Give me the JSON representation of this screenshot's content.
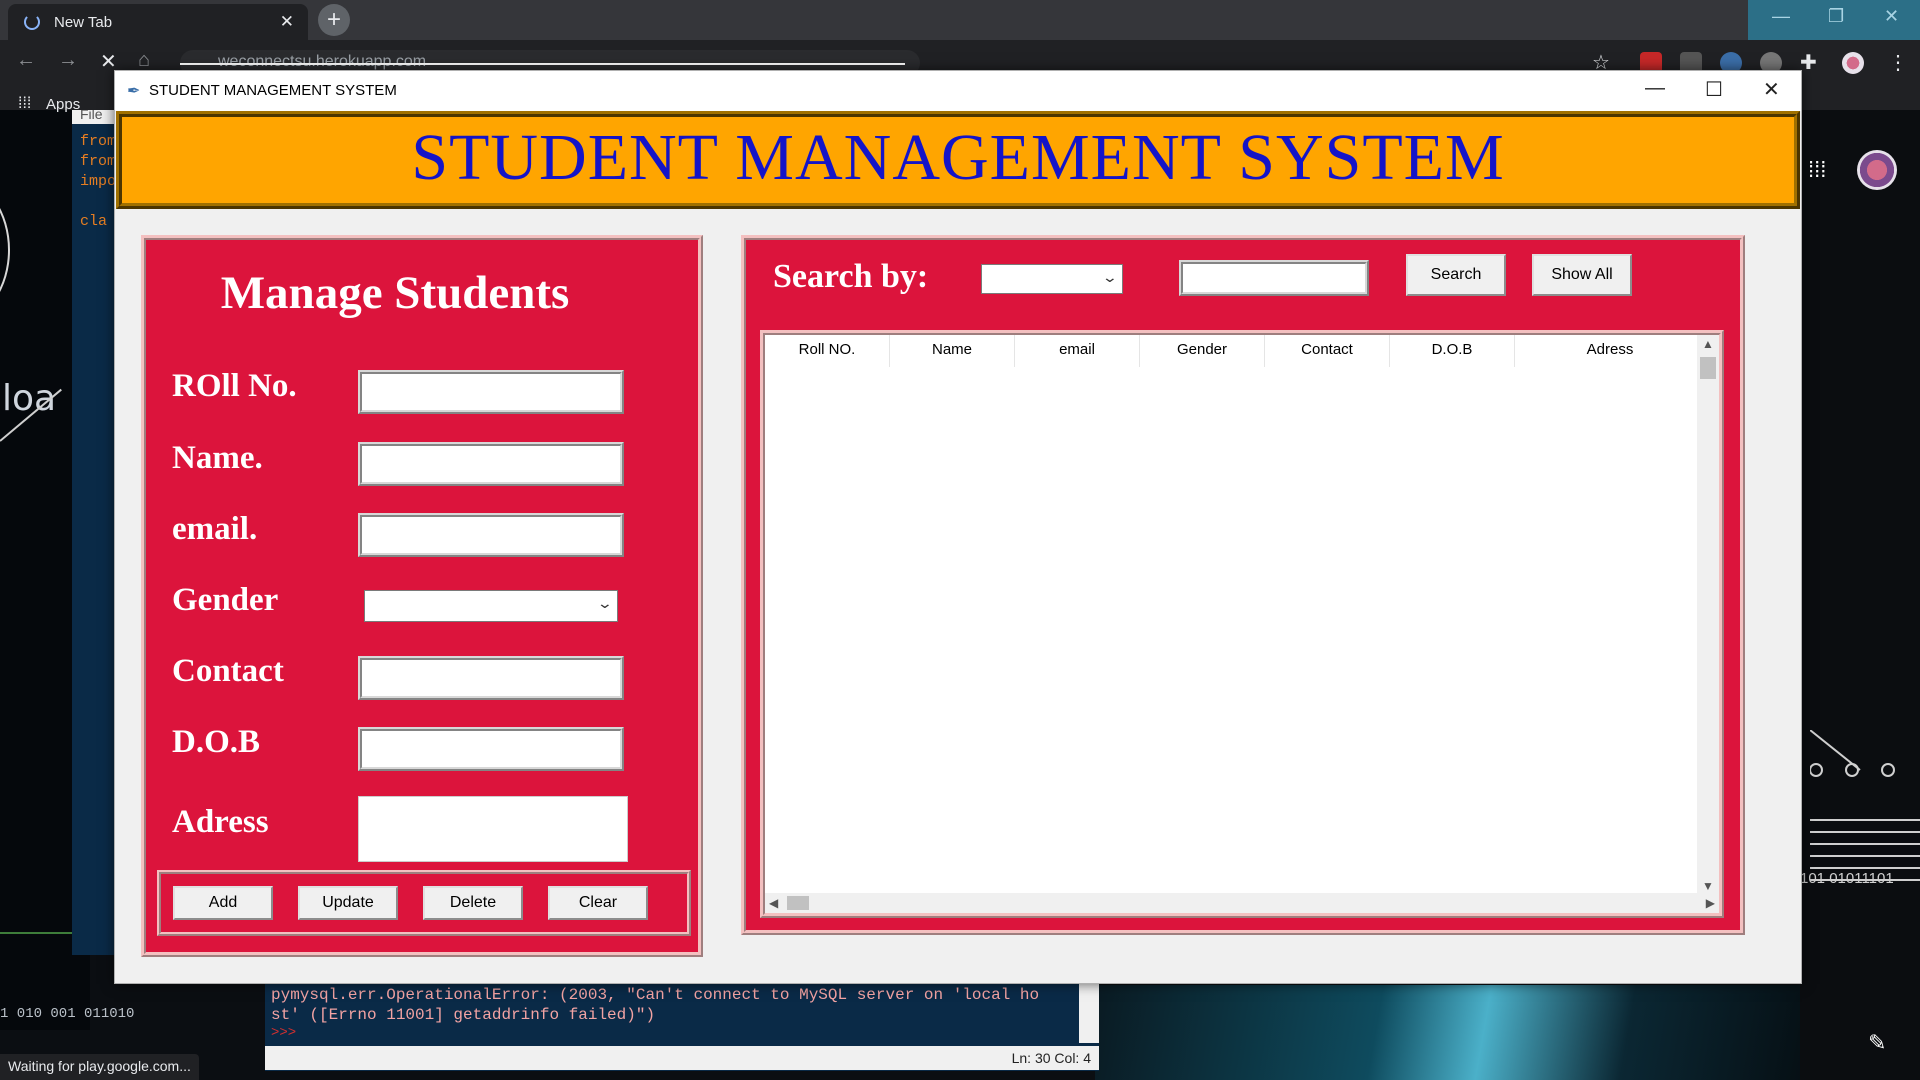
{
  "browser": {
    "tab_title": "New Tab",
    "tab_close": "✕",
    "new_tab": "+",
    "url": "weconnectsu.herokuapp.com",
    "apps_label": "Apps",
    "status": "Waiting for play.google.com..."
  },
  "window": {
    "title": "STUDENT MANAGEMENT SYSTEM",
    "minimize": "—",
    "maximize": "☐",
    "close": "✕"
  },
  "header": {
    "title": "STUDENT MANAGEMENT SYSTEM"
  },
  "manage": {
    "title": "Manage Students",
    "fields": {
      "roll": {
        "label": "ROll No.",
        "value": ""
      },
      "name": {
        "label": "Name.",
        "value": ""
      },
      "email": {
        "label": "email.",
        "value": ""
      },
      "gender": {
        "label": "Gender",
        "value": ""
      },
      "contact": {
        "label": "Contact",
        "value": ""
      },
      "dob": {
        "label": "D.O.B",
        "value": ""
      },
      "address": {
        "label": "Adress",
        "value": ""
      }
    },
    "buttons": {
      "add": "Add",
      "update": "Update",
      "delete": "Delete",
      "clear": "Clear"
    }
  },
  "search": {
    "label": "Search by:",
    "criteria": "",
    "text": "",
    "search_button": "Search",
    "show_all_button": "Show All"
  },
  "table": {
    "columns": [
      "Roll NO.",
      "Name",
      "email",
      "Gender",
      "Contact",
      "D.O.B",
      "Adress"
    ],
    "rows": []
  },
  "shell": {
    "error": "pymysql.err.OperationalError: (2003, \"Can't connect to MySQL server on 'local ho st' ([Errno 11001] getaddrinfo failed)\")",
    "prompt": ">>>",
    "status": "Ln: 30   Col: 4"
  },
  "editor": {
    "file_menu": "File",
    "code": "from\nfrom\nimpo\n\ncla"
  },
  "desktop": {
    "partial_text": "loa",
    "binary_left": "1  010  001 011010",
    "binary_right": "101 01011101"
  },
  "colors": {
    "header_bg": "#ffa500",
    "header_text": "#1414c8",
    "frame_bg": "#dc143c"
  }
}
